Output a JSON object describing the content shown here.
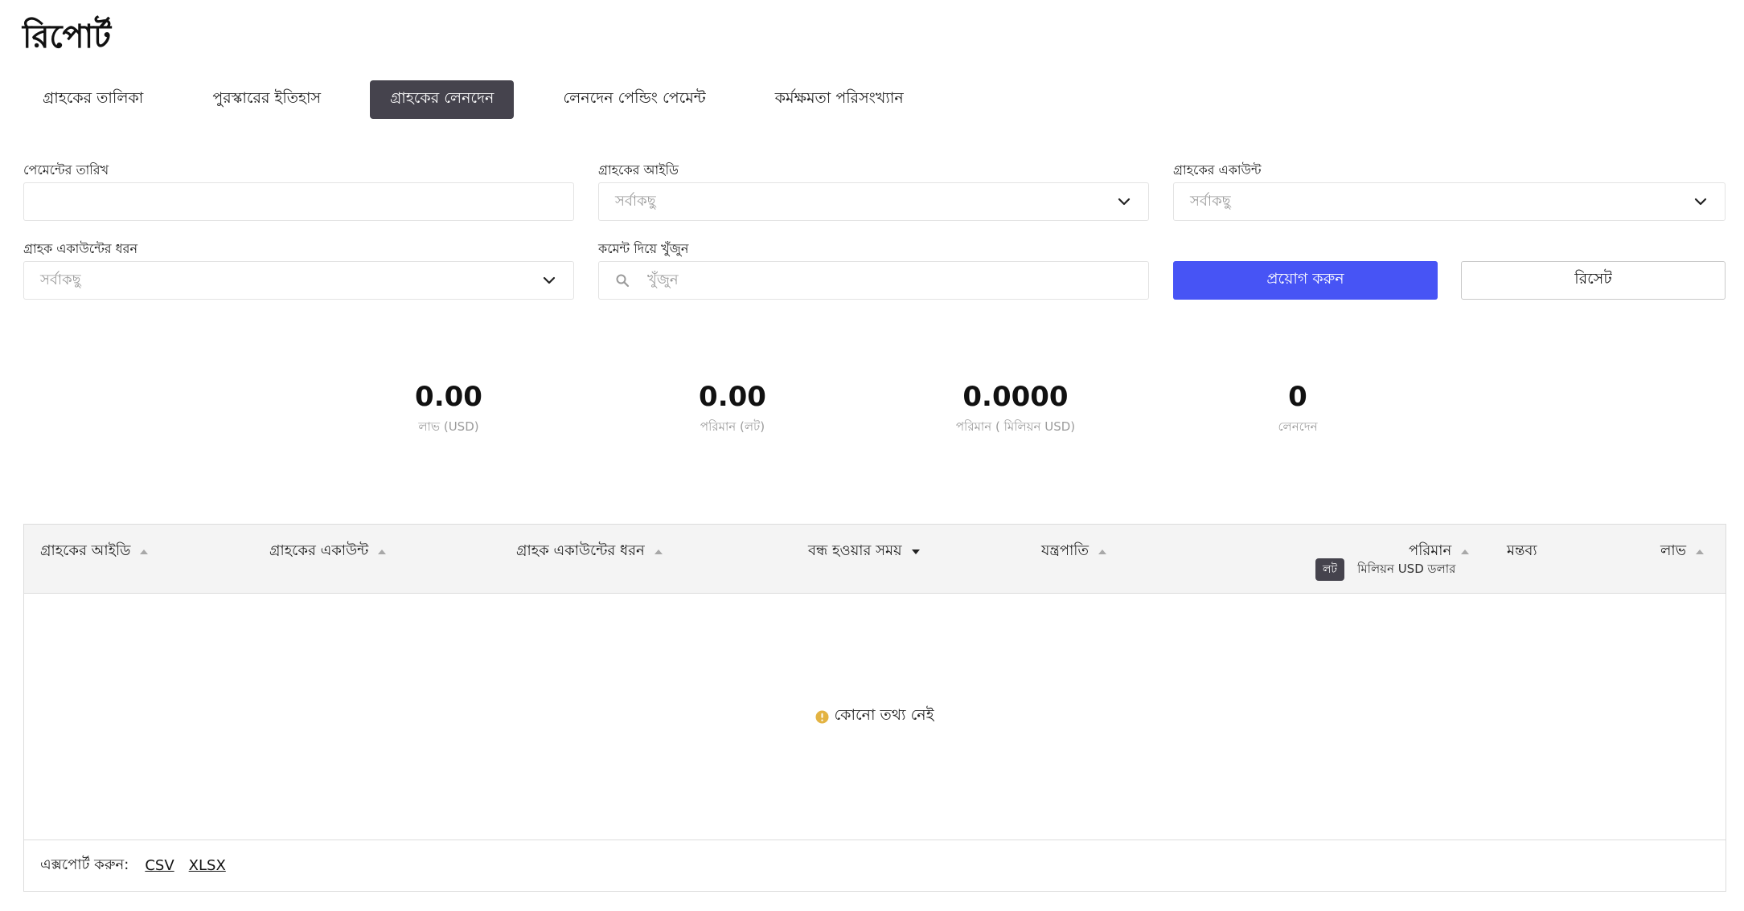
{
  "page": {
    "title": "রিপোর্ট"
  },
  "tabs": [
    {
      "label": "গ্রাহকের তালিকা"
    },
    {
      "label": "পুরস্কারের ইতিহাস"
    },
    {
      "label": "গ্রাহকের লেনদেন"
    },
    {
      "label": "লেনদেন পেন্ডিং পেমেন্ট"
    },
    {
      "label": "কর্মক্ষমতা পরিসংখ্যান"
    }
  ],
  "active_tab": "গ্রাহকের লেনদেন",
  "filters": {
    "payment_date": {
      "label": "পেমেন্টের তারিখ",
      "value": ""
    },
    "client_id": {
      "label": "গ্রাহকের আইডি",
      "placeholder": "সর্বাকছু"
    },
    "client_account": {
      "label": "গ্রাহকের একাউন্ট",
      "placeholder": "সর্বাকছু"
    },
    "account_type": {
      "label": "গ্রাহক একাউন্টের ধরন",
      "placeholder": "সর্বাকছু"
    },
    "comment_search": {
      "label": "কমেন্ট দিয়ে খুঁজুন",
      "placeholder": "খুঁজুন"
    }
  },
  "buttons": {
    "apply": "প্রয়োগ করুন",
    "reset": "রিসেট"
  },
  "stats": [
    {
      "value": "0.00",
      "label": "লাভ (USD)"
    },
    {
      "value": "0.00",
      "label": "পরিমান (লট)"
    },
    {
      "value": "0.0000",
      "label": "পরিমান ( মিলিয়ন USD)"
    },
    {
      "value": "0",
      "label": "লেনদেন"
    }
  ],
  "table": {
    "columns": [
      {
        "label": "গ্রাহকের আইডি",
        "sort": "none"
      },
      {
        "label": "গ্রাহকের একাউন্ট",
        "sort": "none"
      },
      {
        "label": "গ্রাহক একাউন্টের ধরন",
        "sort": "none"
      },
      {
        "label": "বন্ধ হওয়ার সময়",
        "sort": "desc"
      },
      {
        "label": "যন্ত্রপাতি",
        "sort": "none"
      },
      {
        "label": "পরিমান",
        "sort": "none"
      },
      {
        "label": "মন্তব্য",
        "sort": ""
      },
      {
        "label": "লাভ",
        "sort": "none"
      }
    ],
    "unit_toggle": {
      "active": "লট",
      "alternative": "মিলিয়ন USD ডলার"
    },
    "empty_message": "কোনো তথ্য নেই",
    "rows": [],
    "footer": {
      "export_label": "এক্সপোর্ট করুন:",
      "formats": [
        "CSV",
        "XLSX"
      ]
    }
  },
  "colors": {
    "primary": "#4754f5",
    "active_tab": "#45434d",
    "info": "#e3b342"
  }
}
